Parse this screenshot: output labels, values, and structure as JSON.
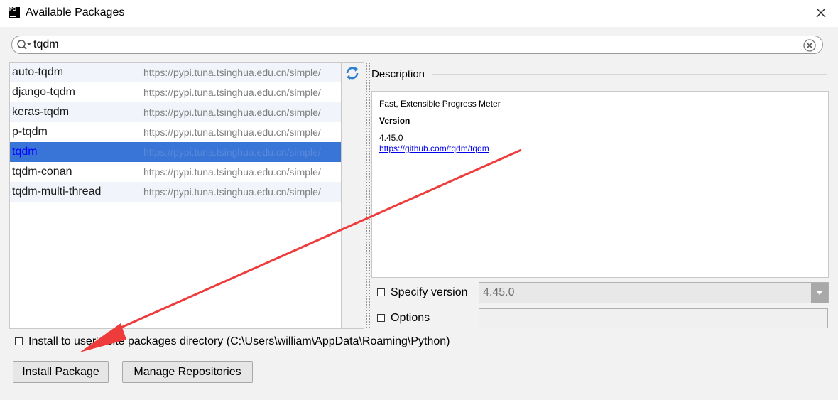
{
  "window": {
    "title": "Available Packages",
    "app_icon_text": "PC"
  },
  "search": {
    "value": "tqdm"
  },
  "packages": [
    {
      "name": "auto-tqdm",
      "url": "https://pypi.tuna.tsinghua.edu.cn/simple/"
    },
    {
      "name": "django-tqdm",
      "url": "https://pypi.tuna.tsinghua.edu.cn/simple/"
    },
    {
      "name": "keras-tqdm",
      "url": "https://pypi.tuna.tsinghua.edu.cn/simple/"
    },
    {
      "name": "p-tqdm",
      "url": "https://pypi.tuna.tsinghua.edu.cn/simple/"
    },
    {
      "name": "tqdm",
      "url": "https://pypi.tuna.tsinghua.edu.cn/simple/"
    },
    {
      "name": "tqdm-conan",
      "url": "https://pypi.tuna.tsinghua.edu.cn/simple/"
    },
    {
      "name": "tqdm-multi-thread",
      "url": "https://pypi.tuna.tsinghua.edu.cn/simple/"
    }
  ],
  "selected_package": "tqdm",
  "description": {
    "label": "Description",
    "summary": "Fast, Extensible Progress Meter",
    "version_heading": "Version",
    "version": "4.45.0",
    "link": "https://github.com/tqdm/tqdm"
  },
  "options": {
    "specify_version_label": "Specify version",
    "specify_version_checked": false,
    "version_value": "4.45.0",
    "options_label": "Options",
    "options_checked": false,
    "options_value": ""
  },
  "install_user_label": "Install to user's site packages directory (C:\\Users\\william\\AppData\\Roaming\\Python)",
  "buttons": {
    "install": "Install Package",
    "manage": "Manage Repositories"
  },
  "colors": {
    "selection": "#3875d7",
    "annotation_arrow": "#ee3b3b"
  },
  "icons": {
    "search": "search-icon",
    "clear": "clear-icon",
    "refresh": "refresh-icon",
    "close": "close-icon",
    "dropdown": "chevron-down-icon"
  }
}
